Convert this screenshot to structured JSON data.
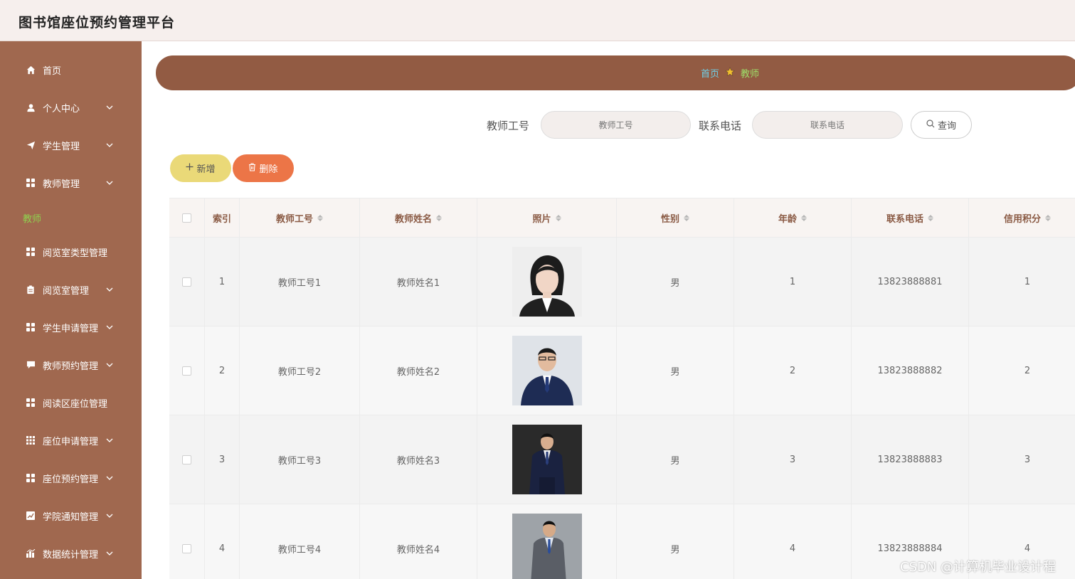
{
  "app": {
    "title": "图书馆座位预约管理平台"
  },
  "sidebar": {
    "items": [
      {
        "label": "首页",
        "icon": "home-icon",
        "expandable": false
      },
      {
        "label": "个人中心",
        "icon": "user-icon",
        "expandable": true
      },
      {
        "label": "学生管理",
        "icon": "send-icon",
        "expandable": true
      },
      {
        "label": "教师管理",
        "icon": "grid-icon",
        "expandable": true
      },
      {
        "label": "阅览室类型管理",
        "icon": "grid-icon",
        "expandable": true
      },
      {
        "label": "阅览室管理",
        "icon": "clipboard-icon",
        "expandable": true
      },
      {
        "label": "学生申请管理",
        "icon": "grid-icon",
        "expandable": true
      },
      {
        "label": "教师预约管理",
        "icon": "message-icon",
        "expandable": true
      },
      {
        "label": "阅读区座位管理",
        "icon": "grid-icon",
        "expandable": true
      },
      {
        "label": "座位申请管理",
        "icon": "grid-9-icon",
        "expandable": true
      },
      {
        "label": "座位预约管理",
        "icon": "grid-icon",
        "expandable": true
      },
      {
        "label": "学院通知管理",
        "icon": "chart-icon",
        "expandable": true
      },
      {
        "label": "数据统计管理",
        "icon": "bar-chart-icon",
        "expandable": true
      }
    ],
    "active_sub": "教师"
  },
  "breadcrumb": {
    "home": "首页",
    "current": "教师"
  },
  "search": {
    "id_label": "教师工号",
    "id_placeholder": "教师工号",
    "phone_label": "联系电话",
    "phone_placeholder": "联系电话",
    "button": "查询"
  },
  "actions": {
    "add": "新增",
    "delete": "删除"
  },
  "table": {
    "headers": [
      "索引",
      "教师工号",
      "教师姓名",
      "照片",
      "性别",
      "年龄",
      "联系电话",
      "信用积分"
    ],
    "rows": [
      {
        "index": "1",
        "id": "教师工号1",
        "name": "教师姓名1",
        "gender": "男",
        "age": "1",
        "phone": "13823888881",
        "credit": "1"
      },
      {
        "index": "2",
        "id": "教师工号2",
        "name": "教师姓名2",
        "gender": "男",
        "age": "2",
        "phone": "13823888882",
        "credit": "2"
      },
      {
        "index": "3",
        "id": "教师工号3",
        "name": "教师姓名3",
        "gender": "男",
        "age": "3",
        "phone": "13823888883",
        "credit": "3"
      },
      {
        "index": "4",
        "id": "教师工号4",
        "name": "教师姓名4",
        "gender": "男",
        "age": "4",
        "phone": "13823888884",
        "credit": "4"
      }
    ]
  },
  "watermark": "CSDN @计算机毕业设计程",
  "colors": {
    "sidebar": "#a0684f",
    "breadcrumb_bar": "#925b43",
    "add_button": "#ead978",
    "delete_button": "#ec7547",
    "header_text": "#8a5a44"
  }
}
